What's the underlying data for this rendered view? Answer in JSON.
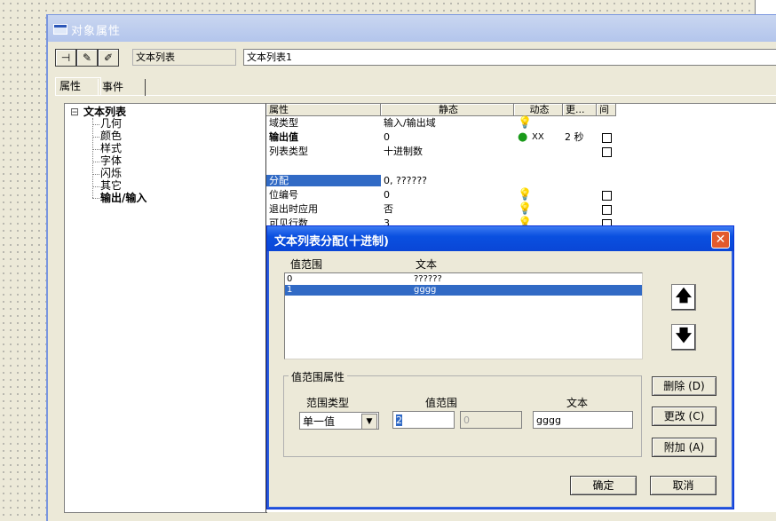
{
  "window": {
    "title": "对象属性"
  },
  "toolbar": {
    "pin_icon": "pin-icon",
    "wand1_icon": "wand-icon",
    "wand2_icon": "wand-pencil-icon"
  },
  "object": {
    "type": "文本列表",
    "name": "文本列表1"
  },
  "tabs": [
    {
      "label": "属性"
    },
    {
      "label": "事件"
    }
  ],
  "tree": {
    "root": "文本列表",
    "collapse": "⊟",
    "children": [
      {
        "label": "几何"
      },
      {
        "label": "颜色"
      },
      {
        "label": "样式"
      },
      {
        "label": "字体"
      },
      {
        "label": "闪烁"
      },
      {
        "label": "其它"
      },
      {
        "label": "输出/输入"
      }
    ]
  },
  "grid": {
    "headers": {
      "property": "属性",
      "static": "静态",
      "dynamic": "动态",
      "update": "更...",
      "indirect": "间"
    },
    "rows": [
      {
        "name": "域类型",
        "static": "输入/输出域",
        "dynamic": "",
        "update": ""
      },
      {
        "name": "输出值",
        "static": "0",
        "dynamic": "XX",
        "update": "2 秒"
      },
      {
        "name": "列表类型",
        "static": "十进制数",
        "dynamic": "",
        "update": ""
      },
      {
        "name": "分配",
        "static": "0, ??????",
        "dynamic": "",
        "update": ""
      },
      {
        "name": "位编号",
        "static": "0",
        "dynamic": "",
        "update": ""
      },
      {
        "name": "退出时应用",
        "static": "否",
        "dynamic": "",
        "update": ""
      },
      {
        "name": "可见行数",
        "static": "3",
        "dynamic": "",
        "update": ""
      }
    ]
  },
  "dialog": {
    "title": "文本列表分配(十进制)",
    "close": "✕",
    "list_headers": {
      "range": "值范围",
      "text": "文本"
    },
    "list_items": [
      {
        "range": "0",
        "text": "??????"
      },
      {
        "range": "1",
        "text": "gggg"
      }
    ],
    "up_arrow": "🡅",
    "down_arrow": "🡇",
    "group_title": "值范围属性",
    "labels": {
      "range_type": "范围类型",
      "value_range": "值范围",
      "text": "文本"
    },
    "range_type_value": "单一值",
    "value_from": "2",
    "value_to": "0",
    "text_value": "gggg",
    "buttons": {
      "delete": "删除 (D)",
      "change": "更改 (C)",
      "append": "附加 (A)",
      "ok": "确定",
      "cancel": "取消"
    }
  }
}
